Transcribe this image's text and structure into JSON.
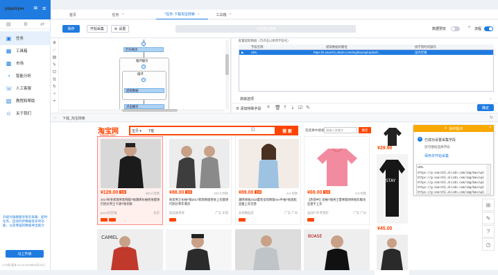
{
  "app": {
    "user": "yejackye",
    "nav": [
      {
        "label": "任务",
        "icon": "task-icon"
      },
      {
        "label": "工具箱",
        "icon": "toolbox-icon"
      },
      {
        "label": "市场",
        "icon": "market-icon"
      },
      {
        "label": "智能分析",
        "icon": "analysis-icon"
      },
      {
        "label": "人工客服",
        "icon": "support-icon"
      },
      {
        "label": "教程和帮助",
        "icon": "help-icon"
      },
      {
        "label": "关于我们",
        "icon": "about-icon"
      }
    ],
    "promo": "升级为旗舰版享受云采集：超时任务、自动同步数据等多项功能，以及增强的数据导出能力",
    "promo_button": "马上升级",
    "footer": "八爪鱼 版本 8.0.8 2019年09月21日"
  },
  "tabs": [
    {
      "label": "首页"
    },
    {
      "label": "任务"
    },
    {
      "label": "*任务-下载淘宝搜索"
    },
    {
      "label": "工具箱"
    }
  ],
  "toolbar": {
    "save": "保存",
    "start": "开始采集",
    "settings": "设置",
    "task_name": "下载淘宝搜索",
    "data_preview": "数据预览",
    "flow": "流程"
  },
  "flow": {
    "nodes": [
      "打开网页",
      "循环翻页",
      "循环",
      "提取数据",
      "点击翻页"
    ]
  },
  "fields": {
    "subtitle": "配置提取数据（可点击以修改字段名）",
    "columns": [
      "字段名称",
      "提取数据的路径",
      "找不到时的操作"
    ],
    "rows": [
      {
        "name": "URL",
        "path": "https://s.search1.alicdn.com/img/bao/uploaded/i...",
        "action": "设为空值"
      }
    ],
    "advanced": "高级选项",
    "add_field": "添加特殊字段",
    "ok": "确定"
  },
  "browser": {
    "title": "下载_淘宝搜索"
  },
  "taobao": {
    "logo": "淘宝网",
    "logo_sub": "Taobao.com",
    "search_type": "宝贝",
    "query": "T恤",
    "search_button": "搜 索",
    "shop_label": "在结果中搜索",
    "shop_placeholder": "请输入关键字",
    "shop_button": "确定"
  },
  "products": [
    {
      "price": "¥129.00",
      "sales": "450人付款",
      "title": "2017秋冬新款男装韩版T恤潮牌长袖修身圆领打底衫男士卡通T恤衣服",
      "shop": "gucci的店铺",
      "loc": "北京"
    },
    {
      "price": "¥88.00",
      "sales": "237人付款",
      "title": "秋装男士长袖T恤2017新款韩版修身上衣圆领打底衫青年潮流",
      "shop": "高品质男装",
      "loc": "广东 东莞"
    },
    {
      "price": "¥89.00",
      "sales": "6人付款",
      "title": "潮牌体恤2018夏装女装韩版mm半袖T恤宽松显瘦上衣百搭",
      "shop": "女装精品店",
      "loc": "广东 广州"
    },
    {
      "price": "¥69.00",
      "sales": "0人付款",
      "title": "【热销中】短袖T恤男士夏季圆领体恤衣服冰丝速干上衣",
      "shop": "运动户外专营店",
      "loc": "广东 广州"
    }
  ],
  "right_prices": [
    "¥29.90",
    "¥45.00"
  ],
  "popup": {
    "head": "操作提示",
    "t1": "已成功设置采集字段",
    "t2": "您可继续选择字段",
    "t3": "保存并开始采集",
    "list_title": "URL",
    "list": [
      "https://g-search1.alicdn.com/img/bao/upl",
      "https://g-search1.alicdn.com/img/bao/upl",
      "https://g-search1.alicdn.com/img/bao/upl",
      "https://g-search1.alicdn.com/img/bao/upl",
      "https://g-search1.alicdn.com/img/bao/upl"
    ]
  },
  "colors": {
    "accent": "#1f7be0",
    "taobao": "#ff4400",
    "popup": "#f9a800"
  }
}
